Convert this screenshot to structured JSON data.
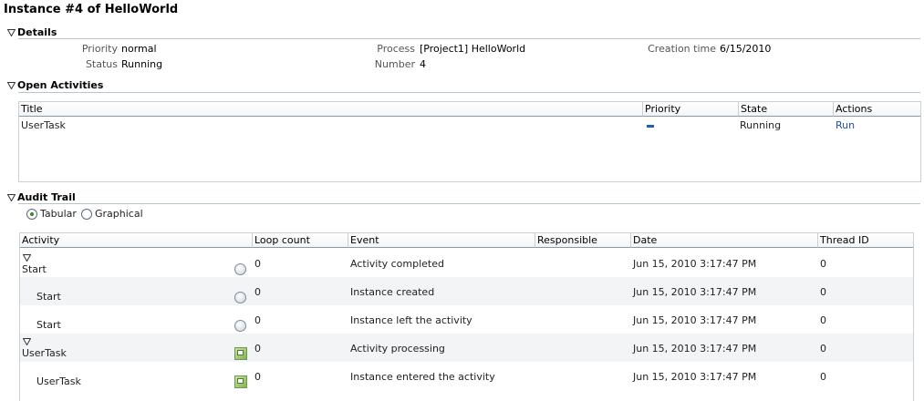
{
  "page": {
    "title": "Instance #4 of HelloWorld"
  },
  "details": {
    "header": "Details",
    "priority_label": "Priority",
    "priority_value": "normal",
    "status_label": "Status",
    "status_value": "Running",
    "process_label": "Process",
    "process_value": "[Project1] HelloWorld",
    "number_label": "Number",
    "number_value": "4",
    "creation_label": "Creation time",
    "creation_value": "6/15/2010"
  },
  "open_activities": {
    "header": "Open Activities",
    "columns": [
      "Title",
      "Priority",
      "State",
      "Actions"
    ],
    "rows": [
      {
        "title": "UserTask",
        "priority": "low",
        "state": "Running",
        "action": "Run"
      }
    ]
  },
  "audit_trail": {
    "header": "Audit Trail",
    "view_options": [
      "Tabular",
      "Graphical"
    ],
    "selected_view": "Tabular",
    "columns": [
      "Activity",
      "Loop count",
      "Event",
      "Responsible",
      "Date",
      "Thread ID"
    ],
    "rows": [
      {
        "activity": "Start",
        "icon": "circle-icon",
        "loop": "0",
        "event": "Activity completed",
        "responsible": "",
        "date": "Jun 15, 2010 3:17:47 PM",
        "thread": "0",
        "group": true
      },
      {
        "activity": "Start",
        "icon": "circle-icon",
        "loop": "0",
        "event": "Instance created",
        "responsible": "",
        "date": "Jun 15, 2010 3:17:47 PM",
        "thread": "0",
        "group": false
      },
      {
        "activity": "Start",
        "icon": "circle-icon",
        "loop": "0",
        "event": "Instance left the activity",
        "responsible": "",
        "date": "Jun 15, 2010 3:17:47 PM",
        "thread": "0",
        "group": false
      },
      {
        "activity": "UserTask",
        "icon": "task-icon",
        "loop": "0",
        "event": "Activity processing",
        "responsible": "",
        "date": "Jun 15, 2010 3:17:47 PM",
        "thread": "0",
        "group": true
      },
      {
        "activity": "UserTask",
        "icon": "task-icon",
        "loop": "0",
        "event": "Instance entered the activity",
        "responsible": "",
        "date": "Jun 15, 2010 3:17:47 PM",
        "thread": "0",
        "group": false
      }
    ]
  },
  "colors": {
    "link": "#1f4fa3",
    "border": "#c7d0d6",
    "alt_row": "#f2f4f5"
  }
}
